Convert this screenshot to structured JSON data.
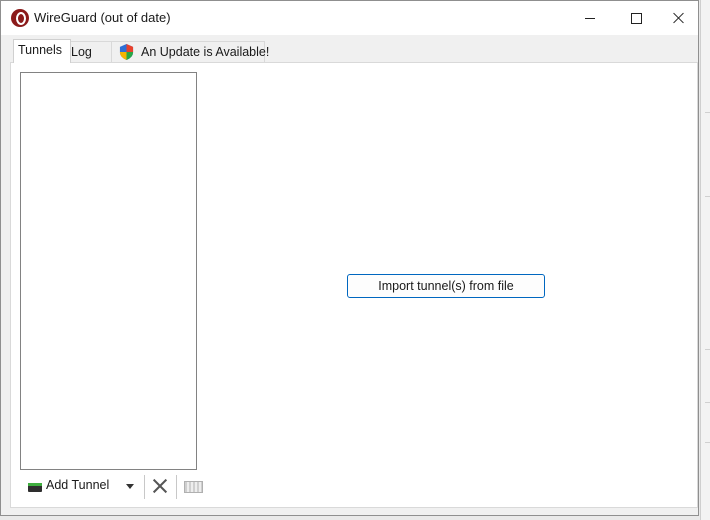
{
  "window": {
    "title": "WireGuard (out of date)",
    "controls": {
      "minimize_icon": "minimize-icon",
      "maximize_icon": "maximize-icon",
      "close_icon": "close-icon"
    }
  },
  "tabs": [
    {
      "label": "Tunnels",
      "selected": true
    },
    {
      "label": "Log",
      "selected": false
    },
    {
      "label": "An Update is Available!",
      "icon": "shield-icon",
      "selected": false
    }
  ],
  "tunnels_panel": {
    "tunnel_list": [],
    "toolbar": {
      "add_tunnel_label": "Add Tunnel",
      "add_icon": "add-tunnel-icon",
      "dropdown_icon": "chevron-down-icon",
      "delete_icon": "delete-icon",
      "export_icon": "export-icon"
    }
  },
  "main": {
    "import_button_label": "Import tunnel(s) from file"
  },
  "colors": {
    "accent": "#0067c0",
    "app_icon": "#8b1a1a",
    "title_bar": "#ffffff",
    "window_bg": "#f0f0f0"
  }
}
